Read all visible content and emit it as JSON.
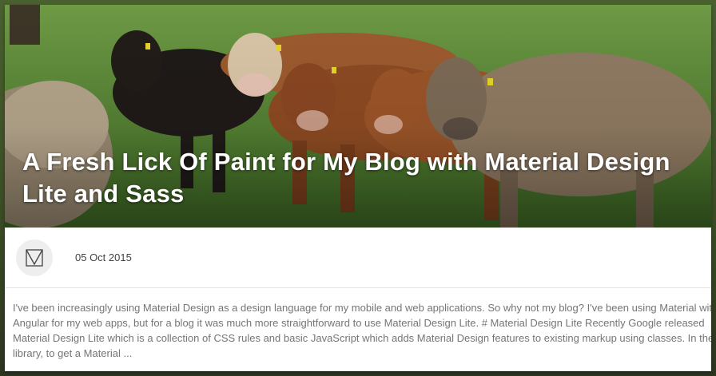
{
  "post": {
    "title": "A Fresh Lick Of Paint for My Blog with Material Design Lite and Sass",
    "date": "05 Oct 2015",
    "excerpt_lines": [
      "I've been increasingly using Material Design as a design language for my mobile and web applications. So why not my blog? I've been using Material with",
      "Angular for my web apps, but for a blog it was much more straightforward to use Material Design Lite. # Material Design Lite Recently Google released",
      "Material Design Lite which is a collection of CSS rules and basic JavaScript which adds Material Design features to existing markup using classes. In the",
      "library, to get a Material ..."
    ],
    "hero_image": "cows-in-field-photo",
    "author_avatar": "material-logo-icon"
  },
  "colors": {
    "title_text": "#ffffff",
    "date_text": "#424242",
    "excerpt_text": "#757575",
    "card_bg": "#ffffff",
    "avatar_bg": "#eeeeee"
  }
}
